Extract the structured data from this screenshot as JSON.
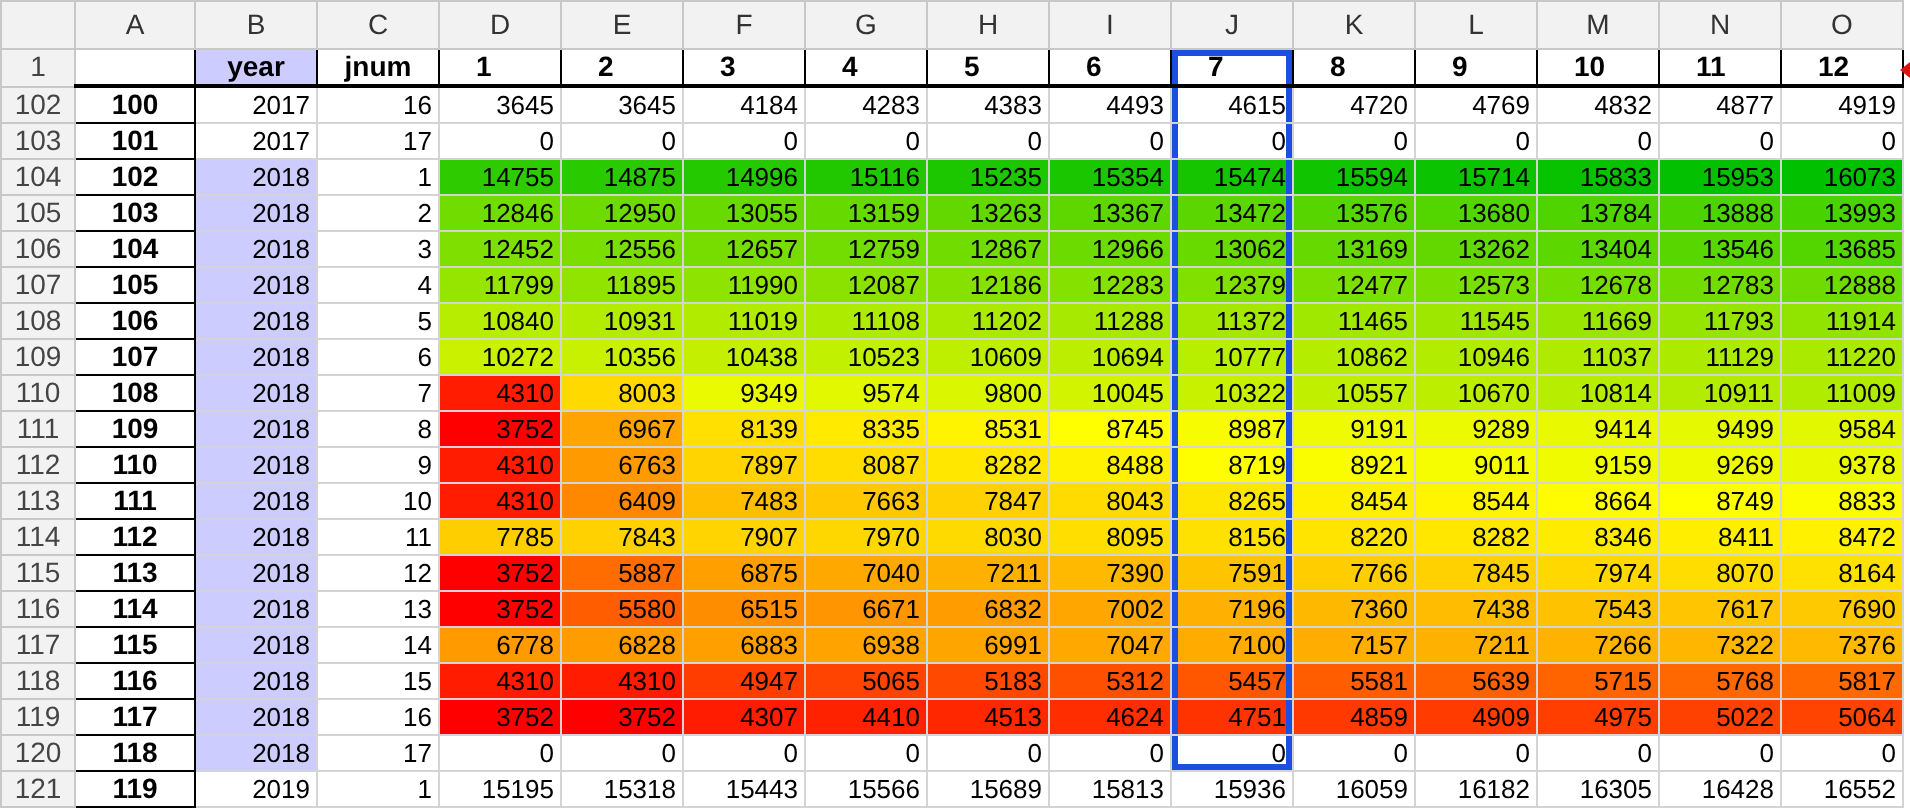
{
  "columns": [
    {
      "letter": "A",
      "selected": false
    },
    {
      "letter": "B",
      "selected": false
    },
    {
      "letter": "C",
      "selected": false
    },
    {
      "letter": "D",
      "selected": false
    },
    {
      "letter": "E",
      "selected": false
    },
    {
      "letter": "F",
      "selected": false
    },
    {
      "letter": "G",
      "selected": false
    },
    {
      "letter": "H",
      "selected": false
    },
    {
      "letter": "I",
      "selected": false
    },
    {
      "letter": "J",
      "selected": true
    },
    {
      "letter": "K",
      "selected": false
    },
    {
      "letter": "L",
      "selected": false
    },
    {
      "letter": "M",
      "selected": false
    },
    {
      "letter": "N",
      "selected": false
    },
    {
      "letter": "O",
      "selected": false
    }
  ],
  "rows": [
    {
      "number": "1",
      "kind": "header",
      "b": "year",
      "c": "jnum",
      "values": [
        "1",
        "2",
        "3",
        "4",
        "5",
        "6",
        "7",
        "8",
        "9",
        "10",
        "11",
        "12"
      ],
      "b_highlight": true,
      "color_scale": false,
      "selected": true
    },
    {
      "number": "102",
      "kind": "data",
      "a": "100",
      "b": "2017",
      "c": "16",
      "values": [
        "3645",
        "3645",
        "4184",
        "4283",
        "4383",
        "4493",
        "4615",
        "4720",
        "4769",
        "4832",
        "4877",
        "4919"
      ],
      "b_highlight": false,
      "color_scale": false,
      "selected": true
    },
    {
      "number": "103",
      "kind": "data",
      "a": "101",
      "b": "2017",
      "c": "17",
      "values": [
        "0",
        "0",
        "0",
        "0",
        "0",
        "0",
        "0",
        "0",
        "0",
        "0",
        "0",
        "0"
      ],
      "b_highlight": false,
      "color_scale": false,
      "selected": true
    },
    {
      "number": "104",
      "kind": "data",
      "a": "102",
      "b": "2018",
      "c": "1",
      "values": [
        "14755",
        "14875",
        "14996",
        "15116",
        "15235",
        "15354",
        "15474",
        "15594",
        "15714",
        "15833",
        "15953",
        "16073"
      ],
      "b_highlight": true,
      "color_scale": true,
      "selected": true
    },
    {
      "number": "105",
      "kind": "data",
      "a": "103",
      "b": "2018",
      "c": "2",
      "values": [
        "12846",
        "12950",
        "13055",
        "13159",
        "13263",
        "13367",
        "13472",
        "13576",
        "13680",
        "13784",
        "13888",
        "13993"
      ],
      "b_highlight": true,
      "color_scale": true,
      "selected": true
    },
    {
      "number": "106",
      "kind": "data",
      "a": "104",
      "b": "2018",
      "c": "3",
      "values": [
        "12452",
        "12556",
        "12657",
        "12759",
        "12867",
        "12966",
        "13062",
        "13169",
        "13262",
        "13404",
        "13546",
        "13685"
      ],
      "b_highlight": true,
      "color_scale": true,
      "selected": true
    },
    {
      "number": "107",
      "kind": "data",
      "a": "105",
      "b": "2018",
      "c": "4",
      "values": [
        "11799",
        "11895",
        "11990",
        "12087",
        "12186",
        "12283",
        "12379",
        "12477",
        "12573",
        "12678",
        "12783",
        "12888"
      ],
      "b_highlight": true,
      "color_scale": true,
      "selected": true
    },
    {
      "number": "108",
      "kind": "data",
      "a": "106",
      "b": "2018",
      "c": "5",
      "values": [
        "10840",
        "10931",
        "11019",
        "11108",
        "11202",
        "11288",
        "11372",
        "11465",
        "11545",
        "11669",
        "11793",
        "11914"
      ],
      "b_highlight": true,
      "color_scale": true,
      "selected": true
    },
    {
      "number": "109",
      "kind": "data",
      "a": "107",
      "b": "2018",
      "c": "6",
      "values": [
        "10272",
        "10356",
        "10438",
        "10523",
        "10609",
        "10694",
        "10777",
        "10862",
        "10946",
        "11037",
        "11129",
        "11220"
      ],
      "b_highlight": true,
      "color_scale": true,
      "selected": true
    },
    {
      "number": "110",
      "kind": "data",
      "a": "108",
      "b": "2018",
      "c": "7",
      "values": [
        "4310",
        "8003",
        "9349",
        "9574",
        "9800",
        "10045",
        "10322",
        "10557",
        "10670",
        "10814",
        "10911",
        "11009"
      ],
      "b_highlight": true,
      "color_scale": true,
      "selected": true
    },
    {
      "number": "111",
      "kind": "data",
      "a": "109",
      "b": "2018",
      "c": "8",
      "values": [
        "3752",
        "6967",
        "8139",
        "8335",
        "8531",
        "8745",
        "8987",
        "9191",
        "9289",
        "9414",
        "9499",
        "9584"
      ],
      "b_highlight": true,
      "color_scale": true,
      "selected": true
    },
    {
      "number": "112",
      "kind": "data",
      "a": "110",
      "b": "2018",
      "c": "9",
      "values": [
        "4310",
        "6763",
        "7897",
        "8087",
        "8282",
        "8488",
        "8719",
        "8921",
        "9011",
        "9159",
        "9269",
        "9378"
      ],
      "b_highlight": true,
      "color_scale": true,
      "selected": true
    },
    {
      "number": "113",
      "kind": "data",
      "a": "111",
      "b": "2018",
      "c": "10",
      "values": [
        "4310",
        "6409",
        "7483",
        "7663",
        "7847",
        "8043",
        "8265",
        "8454",
        "8544",
        "8664",
        "8749",
        "8833"
      ],
      "b_highlight": true,
      "color_scale": true,
      "selected": true
    },
    {
      "number": "114",
      "kind": "data",
      "a": "112",
      "b": "2018",
      "c": "11",
      "values": [
        "7785",
        "7843",
        "7907",
        "7970",
        "8030",
        "8095",
        "8156",
        "8220",
        "8282",
        "8346",
        "8411",
        "8472"
      ],
      "b_highlight": true,
      "color_scale": true,
      "selected": true
    },
    {
      "number": "115",
      "kind": "data",
      "a": "113",
      "b": "2018",
      "c": "12",
      "values": [
        "3752",
        "5887",
        "6875",
        "7040",
        "7211",
        "7390",
        "7591",
        "7766",
        "7845",
        "7974",
        "8070",
        "8164"
      ],
      "b_highlight": true,
      "color_scale": true,
      "selected": true
    },
    {
      "number": "116",
      "kind": "data",
      "a": "114",
      "b": "2018",
      "c": "13",
      "values": [
        "3752",
        "5580",
        "6515",
        "6671",
        "6832",
        "7002",
        "7196",
        "7360",
        "7438",
        "7543",
        "7617",
        "7690"
      ],
      "b_highlight": true,
      "color_scale": true,
      "selected": true
    },
    {
      "number": "117",
      "kind": "data",
      "a": "115",
      "b": "2018",
      "c": "14",
      "values": [
        "6778",
        "6828",
        "6883",
        "6938",
        "6991",
        "7047",
        "7100",
        "7157",
        "7211",
        "7266",
        "7322",
        "7376"
      ],
      "b_highlight": true,
      "color_scale": true,
      "selected": true
    },
    {
      "number": "118",
      "kind": "data",
      "a": "116",
      "b": "2018",
      "c": "15",
      "values": [
        "4310",
        "4310",
        "4947",
        "5065",
        "5183",
        "5312",
        "5457",
        "5581",
        "5639",
        "5715",
        "5768",
        "5817"
      ],
      "b_highlight": true,
      "color_scale": true,
      "selected": true
    },
    {
      "number": "119",
      "kind": "data",
      "a": "117",
      "b": "2018",
      "c": "16",
      "values": [
        "3752",
        "3752",
        "4307",
        "4410",
        "4513",
        "4624",
        "4751",
        "4859",
        "4909",
        "4975",
        "5022",
        "5064"
      ],
      "b_highlight": true,
      "color_scale": true,
      "selected": true
    },
    {
      "number": "120",
      "kind": "data",
      "a": "118",
      "b": "2018",
      "c": "17",
      "values": [
        "0",
        "0",
        "0",
        "0",
        "0",
        "0",
        "0",
        "0",
        "0",
        "0",
        "0",
        "0"
      ],
      "b_highlight": true,
      "color_scale": false,
      "selected": true
    },
    {
      "number": "121",
      "kind": "data",
      "a": "119",
      "b": "2019",
      "c": "1",
      "values": [
        "15195",
        "15318",
        "15443",
        "15566",
        "15689",
        "15813",
        "15936",
        "16059",
        "16182",
        "16305",
        "16428",
        "16552"
      ],
      "b_highlight": false,
      "color_scale": false,
      "selected": false
    }
  ]
}
